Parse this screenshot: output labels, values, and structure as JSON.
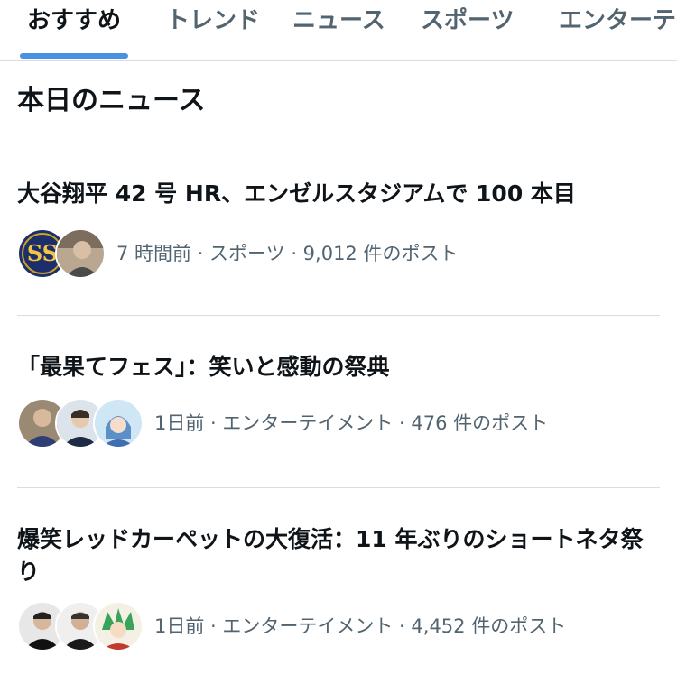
{
  "tabs": [
    {
      "label": "おすすめ",
      "active": true
    },
    {
      "label": "トレンド",
      "active": false
    },
    {
      "label": "ニュース",
      "active": false
    },
    {
      "label": "スポーツ",
      "active": false
    },
    {
      "label": "エンターテ",
      "active": false
    }
  ],
  "section": {
    "title": "本日のニュース"
  },
  "news": [
    {
      "headline": "大谷翔平 42 号 HR、エンゼルスタジアムで 100 本目",
      "meta": "7 時間前 · スポーツ · 9,012 件のポスト",
      "avatars": [
        "team-logo-avatar",
        "person-avatar"
      ]
    },
    {
      "headline": "「最果てフェス」：笑いと感動の祭典",
      "meta": "1日前 · エンターテイメント · 476 件のポスト",
      "avatars": [
        "person-avatar",
        "person-avatar",
        "anime-character-avatar"
      ]
    },
    {
      "headline": "爆笑レッドカーペットの大復活：11 年ぶりのショートネタ祭り",
      "meta": "1日前 · エンターテイメント · 4,452 件のポスト",
      "avatars": [
        "person-avatar",
        "person-avatar",
        "anime-character-avatar"
      ]
    }
  ],
  "colors": {
    "accent": "#4a90e2",
    "text_primary": "#0f1419",
    "text_secondary": "#536471",
    "divider": "#dcdcdc"
  }
}
